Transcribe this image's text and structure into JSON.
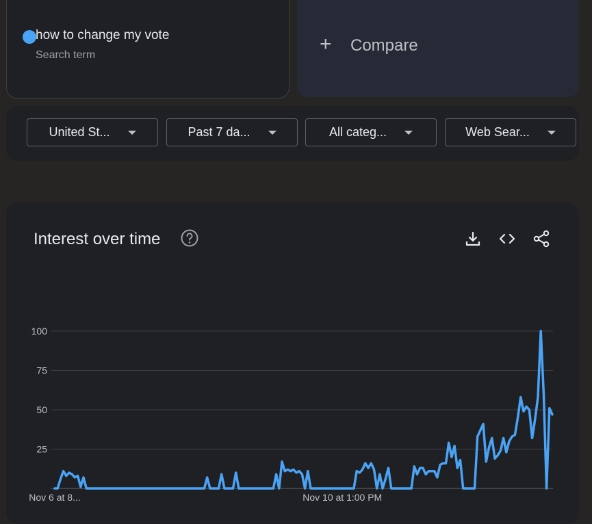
{
  "search_term": {
    "label": "how to change my vote",
    "sublabel": "Search term",
    "color": "#4aa3f5"
  },
  "compare": {
    "label": "Compare"
  },
  "filters": [
    {
      "label": "United St..."
    },
    {
      "label": "Past 7 da..."
    },
    {
      "label": "All categ..."
    },
    {
      "label": "Web Sear..."
    }
  ],
  "chart_section": {
    "title": "Interest over time",
    "icons": [
      "help-icon",
      "download-icon",
      "embed-icon",
      "share-icon"
    ]
  },
  "chart_data": {
    "type": "line",
    "title": "Interest over time",
    "xlabel": "",
    "ylabel": "",
    "ylim": [
      0,
      100
    ],
    "yticks": [
      25,
      50,
      75,
      100
    ],
    "x_tick_labels": [
      {
        "label": "Nov 6 at 8...",
        "index": 0
      },
      {
        "label": "Nov 10 at 1:00 PM",
        "index": 100
      }
    ],
    "grid": true,
    "series": [
      {
        "color": "#4aa3f5",
        "values": [
          0,
          0,
          6,
          11,
          8,
          10,
          9,
          7,
          8,
          1,
          7,
          0,
          0,
          0,
          0,
          0,
          0,
          0,
          0,
          0,
          0,
          0,
          0,
          0,
          0,
          0,
          0,
          0,
          0,
          0,
          0,
          0,
          0,
          0,
          0,
          0,
          0,
          0,
          0,
          0,
          0,
          0,
          0,
          0,
          0,
          0,
          0,
          0,
          0,
          0,
          0,
          0,
          0,
          7,
          0,
          0,
          0,
          0,
          9,
          0,
          0,
          0,
          0,
          10,
          0,
          0,
          0,
          0,
          0,
          0,
          0,
          0,
          0,
          0,
          0,
          0,
          0,
          9,
          0,
          17,
          11,
          12,
          11,
          12,
          10,
          11,
          9,
          0,
          11,
          0,
          0,
          0,
          0,
          0,
          0,
          0,
          0,
          0,
          0,
          0,
          0,
          0,
          0,
          0,
          0,
          11,
          10,
          12,
          16,
          13,
          16,
          12,
          0,
          9,
          0,
          6,
          13,
          0,
          0,
          0,
          0,
          0,
          0,
          0,
          0,
          14,
          9,
          13,
          13,
          9,
          11,
          11,
          11,
          7,
          15,
          16,
          16,
          29,
          20,
          27,
          13,
          18,
          0,
          0,
          0,
          0,
          0,
          33,
          37,
          41,
          17,
          26,
          32,
          19,
          21,
          24,
          32,
          23,
          30,
          33,
          34,
          45,
          58,
          49,
          52,
          50,
          32,
          44,
          58,
          100,
          60,
          0,
          51,
          47
        ]
      }
    ]
  }
}
